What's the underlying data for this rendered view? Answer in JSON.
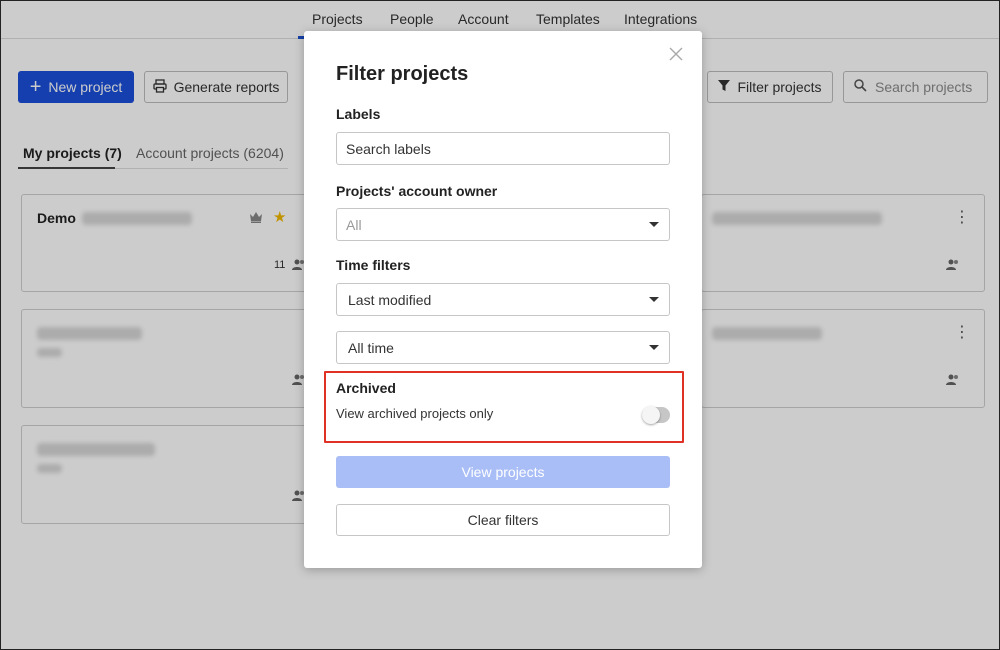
{
  "nav": {
    "tabs": [
      "Projects",
      "People",
      "Account",
      "Templates",
      "Integrations"
    ],
    "active": "Projects"
  },
  "toolbar": {
    "new_project": "New project",
    "generate_reports": "Generate reports",
    "filter_projects": "Filter projects",
    "search_placeholder": "Search projects"
  },
  "subtabs": {
    "my_projects": "My projects (7)",
    "account_projects": "Account projects (6204)"
  },
  "cards": [
    {
      "title": "Demo",
      "member_count": "11"
    }
  ],
  "modal": {
    "title": "Filter projects",
    "labels": {
      "heading": "Labels",
      "placeholder": "Search labels"
    },
    "owner": {
      "heading": "Projects' account owner",
      "selected": "All"
    },
    "time": {
      "heading": "Time filters",
      "field_selected": "Last modified",
      "range_selected": "All time"
    },
    "archived": {
      "heading": "Archived",
      "toggle_label": "View archived projects only",
      "toggle_on": false
    },
    "view_button": "View projects",
    "clear_button": "Clear filters"
  },
  "colors": {
    "primary": "#1b4fdb",
    "primary_disabled": "#a9bdf7",
    "highlight": "#e03127",
    "star": "#f0b800"
  }
}
